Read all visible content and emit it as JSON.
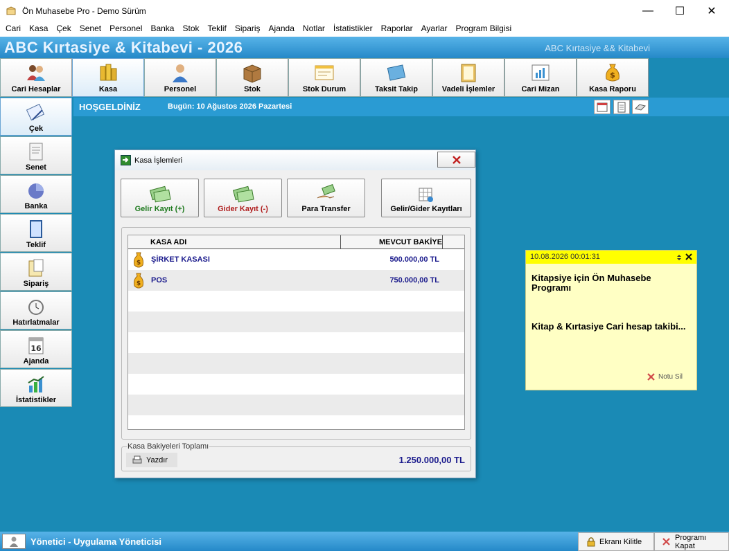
{
  "window": {
    "title": "Ön Muhasebe Pro - Demo Sürüm",
    "minimize": "—",
    "maximize": "☐",
    "close": "✕"
  },
  "menu": [
    "Cari",
    "Kasa",
    "Çek",
    "Senet",
    "Personel",
    "Banka",
    "Stok",
    "Teklif",
    "Sipariş",
    "Ajanda",
    "Notlar",
    "İstatistikler",
    "Raporlar",
    "Ayarlar",
    "Program Bilgisi"
  ],
  "banner": {
    "company": "ABC Kırtasiye & Kitabevi - 2026",
    "company_right": "ABC Kırtasiye && Kitabevi"
  },
  "toolbar": [
    {
      "label": "Cari Hesaplar",
      "icon": "people-icon"
    },
    {
      "label": "Kasa",
      "icon": "coins-icon"
    },
    {
      "label": "Personel",
      "icon": "person-icon"
    },
    {
      "label": "Stok",
      "icon": "box-icon"
    },
    {
      "label": "Stok Durum",
      "icon": "window-icon"
    },
    {
      "label": "Taksit Takip",
      "icon": "card-icon"
    },
    {
      "label": "Vadeli İşlemler",
      "icon": "folder-icon"
    },
    {
      "label": "Cari Mizan",
      "icon": "chart-doc-icon"
    },
    {
      "label": "Kasa Raporu",
      "icon": "money-bag-icon"
    }
  ],
  "welcome": {
    "greeting": "HOŞGELDİNİZ",
    "today": "Bugün: 10 Ağustos 2026 Pazartesi"
  },
  "sidebar": [
    {
      "label": "Çek",
      "icon": "cheque-icon"
    },
    {
      "label": "Senet",
      "icon": "document-icon"
    },
    {
      "label": "Banka",
      "icon": "pie-chart-icon"
    },
    {
      "label": "Teklif",
      "icon": "tablet-icon"
    },
    {
      "label": "Sipariş",
      "icon": "order-icon"
    },
    {
      "label": "Hatırlatmalar",
      "icon": "alarm-clock-icon"
    },
    {
      "label": "Ajanda",
      "icon": "calendar-icon"
    },
    {
      "label": "İstatistikler",
      "icon": "stats-icon"
    }
  ],
  "calendar_day": "16",
  "dialog": {
    "title": "Kasa İşlemleri",
    "buttons": {
      "income": "Gelir Kayıt (+)",
      "expense": "Gider Kayıt (-)",
      "transfer": "Para Transfer",
      "records": "Gelir/Gider Kayıtları"
    },
    "columns": {
      "name": "KASA ADI",
      "balance": "MEVCUT BAKİYE"
    },
    "rows": [
      {
        "name": "ŞİRKET KASASI",
        "balance": "500.000,00 TL"
      },
      {
        "name": "POS",
        "balance": "750.000,00 TL"
      }
    ],
    "total_legend": "Kasa Bakiyeleri Toplamı",
    "print_label": "Yazdır",
    "total": "1.250.000,00 TL"
  },
  "note": {
    "date": "10.08.2026 00:01:31",
    "line1": "Kitapsiye için Ön Muhasebe Programı",
    "line2": "Kitap & Kırtasiye Cari hesap takibi...",
    "delete": "Notu Sil"
  },
  "status": {
    "user": "Yönetici - Uygulama Yöneticisi",
    "lock": "Ekranı Kilitle",
    "exit": "Programı Kapat"
  },
  "colors": {
    "desktop": "#1a8ab5",
    "banner": "#2589c8",
    "income": "#1e7a1e",
    "expense": "#b01e1e",
    "value_blue": "#1a1a8c"
  }
}
